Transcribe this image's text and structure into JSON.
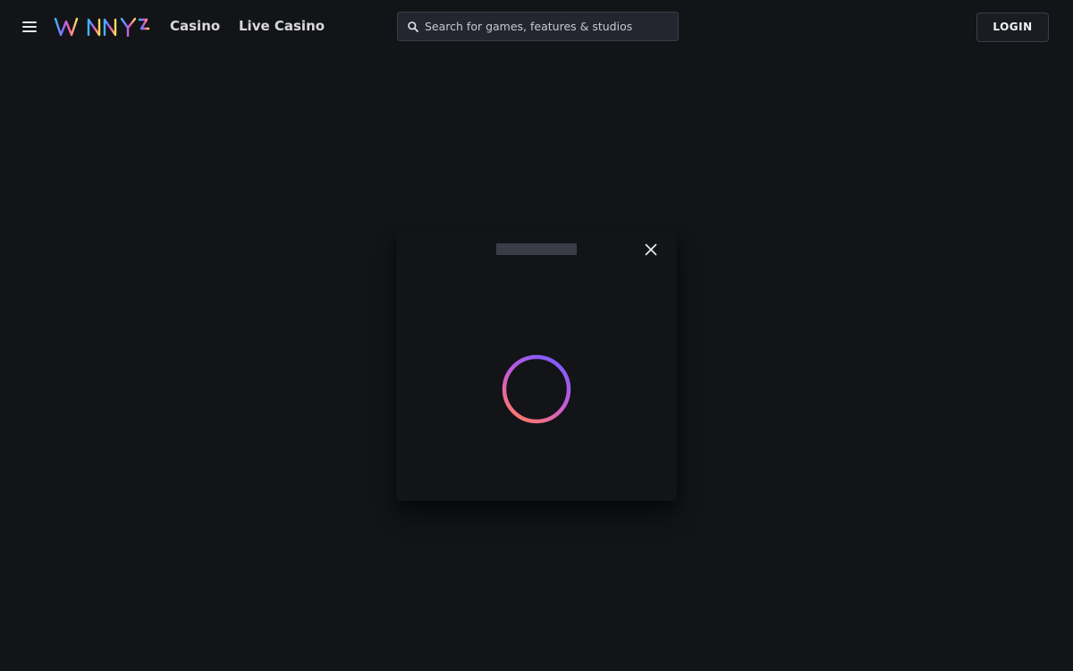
{
  "header": {
    "menu_icon": "hamburger-menu-icon",
    "logo_text": "WINNY",
    "nav": [
      {
        "label": "Casino"
      },
      {
        "label": "Live Casino"
      }
    ],
    "search": {
      "icon": "search-icon",
      "placeholder": "Search for games, features & studios",
      "value": ""
    },
    "login_label": "LOGIN"
  },
  "modal": {
    "close_icon": "close-icon",
    "loading_icon": "loading-spinner-icon"
  },
  "colors": {
    "background": "#121418",
    "search_bg": "#23262f",
    "border": "#3a3d47",
    "text": "#d9d9dd",
    "spinner_gradient": [
      "#7b5cff",
      "#c85ad6",
      "#ff7a66"
    ]
  }
}
